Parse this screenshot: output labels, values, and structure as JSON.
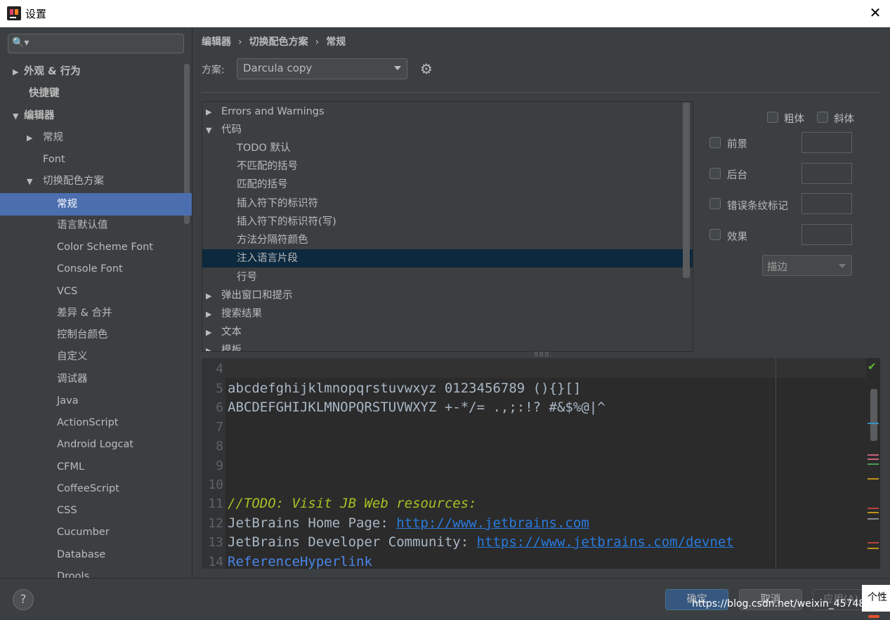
{
  "window": {
    "title": "设置",
    "close_glyph": "✕"
  },
  "sidebar": {
    "search_placeholder": "",
    "search_glyph": "🔍▾",
    "items": [
      {
        "label": "外观 & 行为",
        "tri": "▶"
      },
      {
        "label": "快捷键",
        "tri": ""
      },
      {
        "label": "编辑器",
        "tri": "▼"
      },
      {
        "label": "常规",
        "tri": "▶"
      },
      {
        "label": "Font",
        "tri": ""
      },
      {
        "label": "切换配色方案",
        "tri": "▼"
      },
      {
        "label": "常规",
        "tri": ""
      },
      {
        "label": "语言默认值",
        "tri": ""
      },
      {
        "label": "Color Scheme Font",
        "tri": ""
      },
      {
        "label": "Console Font",
        "tri": ""
      },
      {
        "label": "VCS",
        "tri": ""
      },
      {
        "label": "差异 & 合并",
        "tri": ""
      },
      {
        "label": "控制台颜色",
        "tri": ""
      },
      {
        "label": "自定义",
        "tri": ""
      },
      {
        "label": "调试器",
        "tri": ""
      },
      {
        "label": "Java",
        "tri": ""
      },
      {
        "label": "ActionScript",
        "tri": ""
      },
      {
        "label": "Android Logcat",
        "tri": ""
      },
      {
        "label": "CFML",
        "tri": ""
      },
      {
        "label": "CoffeeScript",
        "tri": ""
      },
      {
        "label": "CSS",
        "tri": ""
      },
      {
        "label": "Cucumber",
        "tri": ""
      },
      {
        "label": "Database",
        "tri": ""
      },
      {
        "label": "Drools",
        "tri": ""
      }
    ]
  },
  "breadcrumb": {
    "part1": "编辑器",
    "part2": "切换配色方案",
    "part3": "常规",
    "sep": "›"
  },
  "scheme": {
    "label": "方案:",
    "value": "Darcula copy"
  },
  "options_tree": {
    "items": [
      {
        "label": "Errors and Warnings",
        "tri": "▶"
      },
      {
        "label": "代码",
        "tri": "▼"
      },
      {
        "label": "TODO 默认",
        "tri": ""
      },
      {
        "label": "不匹配的括号",
        "tri": ""
      },
      {
        "label": "匹配的括号",
        "tri": ""
      },
      {
        "label": "插入符下的标识符",
        "tri": ""
      },
      {
        "label": "插入符下的标识符(写)",
        "tri": ""
      },
      {
        "label": "方法分隔符颜色",
        "tri": ""
      },
      {
        "label": "注入语言片段",
        "tri": ""
      },
      {
        "label": "行号",
        "tri": ""
      },
      {
        "label": "弹出窗口和提示",
        "tri": "▶"
      },
      {
        "label": "搜索结果",
        "tri": "▶"
      },
      {
        "label": "文本",
        "tri": "▶"
      },
      {
        "label": "模板",
        "tri": "▶"
      }
    ]
  },
  "attributes": {
    "bold": "粗体",
    "italic": "斜体",
    "foreground": "前景",
    "background": "后台",
    "error_stripe": "错误条纹标记",
    "effects": "效果",
    "effect_type": "描边"
  },
  "preview": {
    "lines": [
      {
        "n": "4",
        "text": ""
      },
      {
        "n": "5",
        "text": "abcdefghijklmnopqrstuvwxyz 0123456789 (){}[]"
      },
      {
        "n": "6",
        "text": "ABCDEFGHIJKLMNOPQRSTUVWXYZ +-*/= .,;:!? #&$%@|^"
      },
      {
        "n": "7",
        "text": ""
      },
      {
        "n": "8",
        "text": ""
      },
      {
        "n": "9",
        "text": ""
      },
      {
        "n": "10",
        "text": ""
      },
      {
        "n": "11",
        "text": "//TODO: Visit JB Web resources:"
      },
      {
        "n": "12",
        "label": "JetBrains Home Page: ",
        "link": "http://www.jetbrains.com"
      },
      {
        "n": "13",
        "label": "JetBrains Developer Community: ",
        "link": "https://www.jetbrains.com/devnet"
      },
      {
        "n": "14",
        "text": "ReferenceHyperlink"
      }
    ],
    "check_glyph": "✔"
  },
  "buttons": {
    "help": "?",
    "ok": "确定",
    "cancel": "取消",
    "apply": "应用(A)"
  },
  "watermark": "https://blog.csdn.net/weixin_45748",
  "tooltip": "个性"
}
